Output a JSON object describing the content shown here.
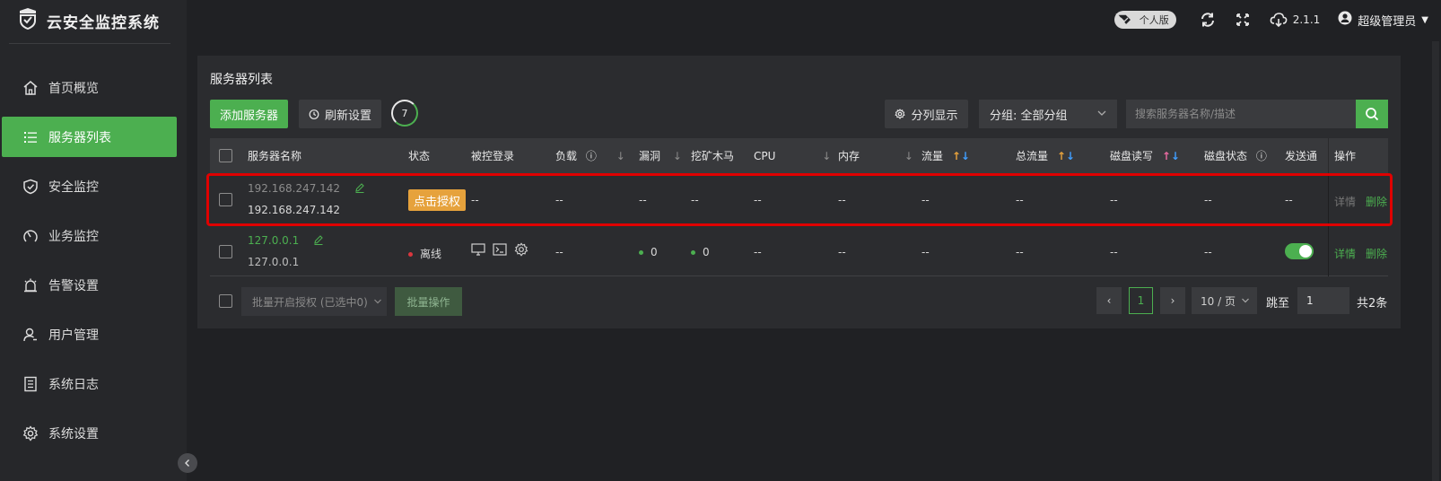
{
  "app": {
    "title": "云安全监控系统"
  },
  "topbar": {
    "edition": "个人版",
    "version": "2.1.1",
    "user": "超级管理员"
  },
  "sidebar": {
    "items": [
      {
        "label": "首页概览",
        "icon": "home-icon"
      },
      {
        "label": "服务器列表",
        "icon": "list-icon",
        "active": true
      },
      {
        "label": "安全监控",
        "icon": "shield-icon"
      },
      {
        "label": "业务监控",
        "icon": "gauge-icon"
      },
      {
        "label": "告警设置",
        "icon": "alarm-icon"
      },
      {
        "label": "用户管理",
        "icon": "user-icon"
      },
      {
        "label": "系统日志",
        "icon": "log-icon"
      },
      {
        "label": "系统设置",
        "icon": "gear-icon"
      }
    ]
  },
  "panel": {
    "title": "服务器列表",
    "add_label": "添加服务器",
    "refresh_label": "刷新设置",
    "refresh_count": "7",
    "columns_label": "分列显示",
    "group_label": "分组: 全部分组",
    "search_placeholder": "搜索服务器名称/描述"
  },
  "table": {
    "headers": {
      "name": "服务器名称",
      "status": "状态",
      "login": "被控登录",
      "load": "负载",
      "vuln": "漏洞",
      "miner": "挖矿木马",
      "cpu": "CPU",
      "mem": "内存",
      "traffic": "流量",
      "total_traffic": "总流量",
      "disk_io": "磁盘读写",
      "disk_state": "磁盘状态",
      "send": "发送通",
      "ops": "操作"
    },
    "rows": [
      {
        "ip_top": "192.168.247.142",
        "ip_bottom": "192.168.247.142",
        "status": "点击授权",
        "login": "--",
        "load": "--",
        "vuln": "--",
        "miner": "--",
        "cpu": "--",
        "mem": "--",
        "traffic": "--",
        "total_traffic": "--",
        "disk_io": "--",
        "disk_state": "--",
        "send": "--",
        "detail": "详情",
        "delete": "删除"
      },
      {
        "ip_top": "127.0.0.1",
        "ip_bottom": "127.0.0.1",
        "status": "离线",
        "load": "--",
        "vuln": "0",
        "miner": "0",
        "cpu": "--",
        "mem": "--",
        "traffic": "--",
        "total_traffic": "--",
        "disk_io": "--",
        "disk_state": "--",
        "send_enabled": true,
        "detail": "详情",
        "delete": "删除"
      }
    ]
  },
  "footer": {
    "batch_select": "批量开启授权 (已选中0)",
    "batch_button": "批量操作",
    "current_page": "1",
    "page_size": "10 / 页",
    "jump_label": "跳至",
    "jump_value": "1",
    "total": "共2条"
  },
  "colors": {
    "accent": "#4caf50",
    "warning": "#e6a23c",
    "highlight": "#e00000",
    "offline": "#d9363e"
  }
}
